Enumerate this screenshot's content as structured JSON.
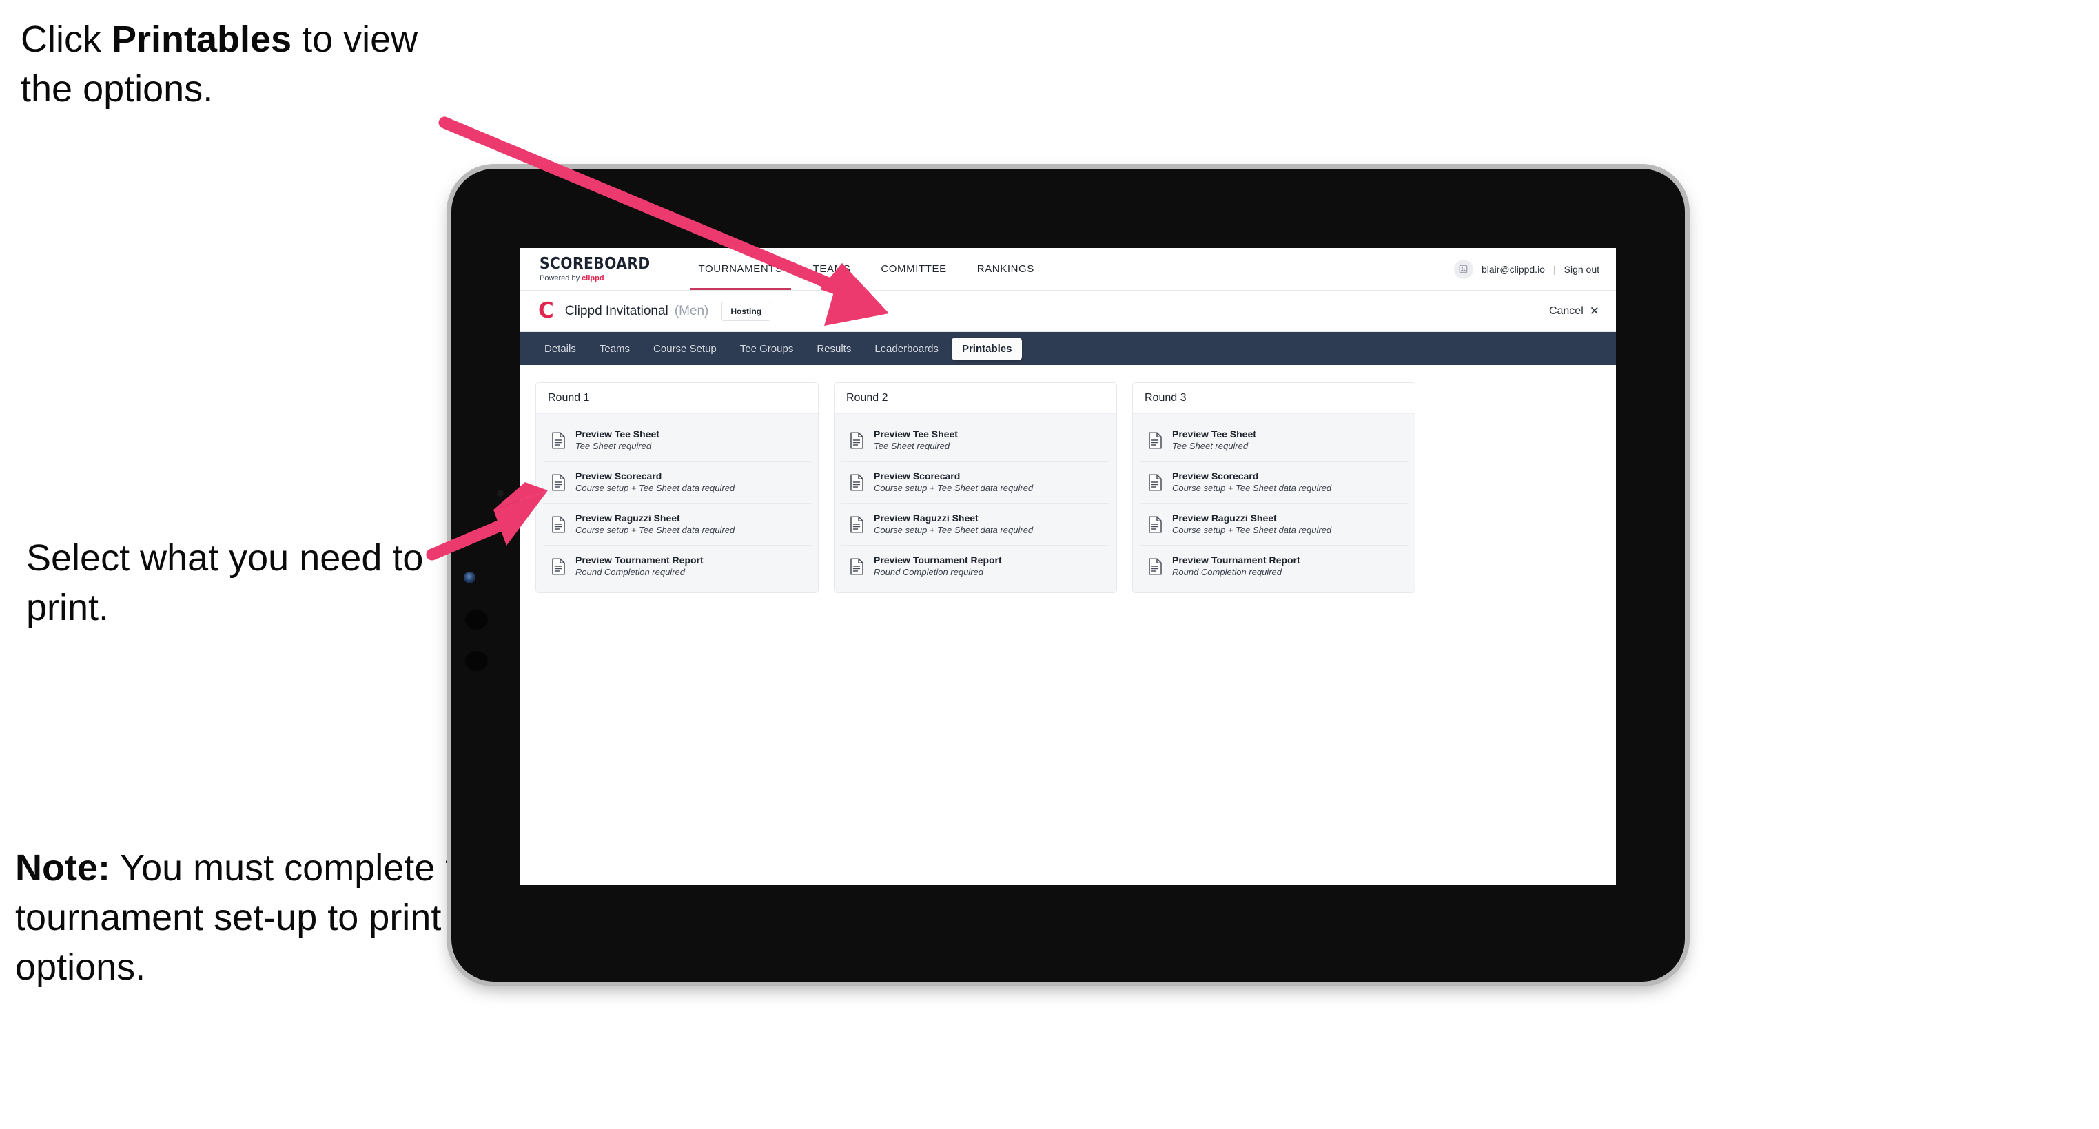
{
  "annotations": {
    "click_printables": {
      "pre": "Click ",
      "bold": "Printables",
      "post": " to view the options."
    },
    "select_print": "Select what you need to print.",
    "note": {
      "bold": "Note:",
      "text": " You must complete the tournament set-up to print all the options."
    }
  },
  "colors": {
    "accent_pink": "#ec3a6e",
    "nav_navy": "#2e3c53",
    "brand_red": "#e0274f",
    "tab_underline": "#c8375c"
  },
  "app": {
    "brand": {
      "title": "SCOREBOARD",
      "sub_prefix": "Powered by ",
      "sub_brand": "clippd"
    },
    "main_nav": [
      {
        "label": "TOURNAMENTS",
        "active": true
      },
      {
        "label": "TEAMS",
        "active": false
      },
      {
        "label": "COMMITTEE",
        "active": false
      },
      {
        "label": "RANKINGS",
        "active": false
      }
    ],
    "account": {
      "avatar_icon": "user-avatar-icon",
      "email": "blair@clippd.io",
      "separator": "|",
      "sign_out": "Sign out"
    },
    "tournament": {
      "logo_letter": "C",
      "name": "Clippd Invitational",
      "gender": "(Men)",
      "badge": "Hosting",
      "cancel_label": "Cancel",
      "cancel_icon": "close-icon"
    },
    "tabs": [
      {
        "label": "Details",
        "active": false
      },
      {
        "label": "Teams",
        "active": false
      },
      {
        "label": "Course Setup",
        "active": false
      },
      {
        "label": "Tee Groups",
        "active": false
      },
      {
        "label": "Results",
        "active": false
      },
      {
        "label": "Leaderboards",
        "active": false
      },
      {
        "label": "Printables",
        "active": true
      }
    ],
    "rounds": [
      {
        "title": "Round 1",
        "items": [
          {
            "icon": "document-icon",
            "title": "Preview Tee Sheet",
            "sub": "Tee Sheet required"
          },
          {
            "icon": "document-icon",
            "title": "Preview Scorecard",
            "sub": "Course setup + Tee Sheet data required"
          },
          {
            "icon": "document-icon",
            "title": "Preview Raguzzi Sheet",
            "sub": "Course setup + Tee Sheet data required"
          },
          {
            "icon": "document-icon",
            "title": "Preview Tournament Report",
            "sub": "Round Completion required"
          }
        ]
      },
      {
        "title": "Round 2",
        "items": [
          {
            "icon": "document-icon",
            "title": "Preview Tee Sheet",
            "sub": "Tee Sheet required"
          },
          {
            "icon": "document-icon",
            "title": "Preview Scorecard",
            "sub": "Course setup + Tee Sheet data required"
          },
          {
            "icon": "document-icon",
            "title": "Preview Raguzzi Sheet",
            "sub": "Course setup + Tee Sheet data required"
          },
          {
            "icon": "document-icon",
            "title": "Preview Tournament Report",
            "sub": "Round Completion required"
          }
        ]
      },
      {
        "title": "Round 3",
        "items": [
          {
            "icon": "document-icon",
            "title": "Preview Tee Sheet",
            "sub": "Tee Sheet required"
          },
          {
            "icon": "document-icon",
            "title": "Preview Scorecard",
            "sub": "Course setup + Tee Sheet data required"
          },
          {
            "icon": "document-icon",
            "title": "Preview Raguzzi Sheet",
            "sub": "Course setup + Tee Sheet data required"
          },
          {
            "icon": "document-icon",
            "title": "Preview Tournament Report",
            "sub": "Round Completion required"
          }
        ]
      }
    ]
  }
}
